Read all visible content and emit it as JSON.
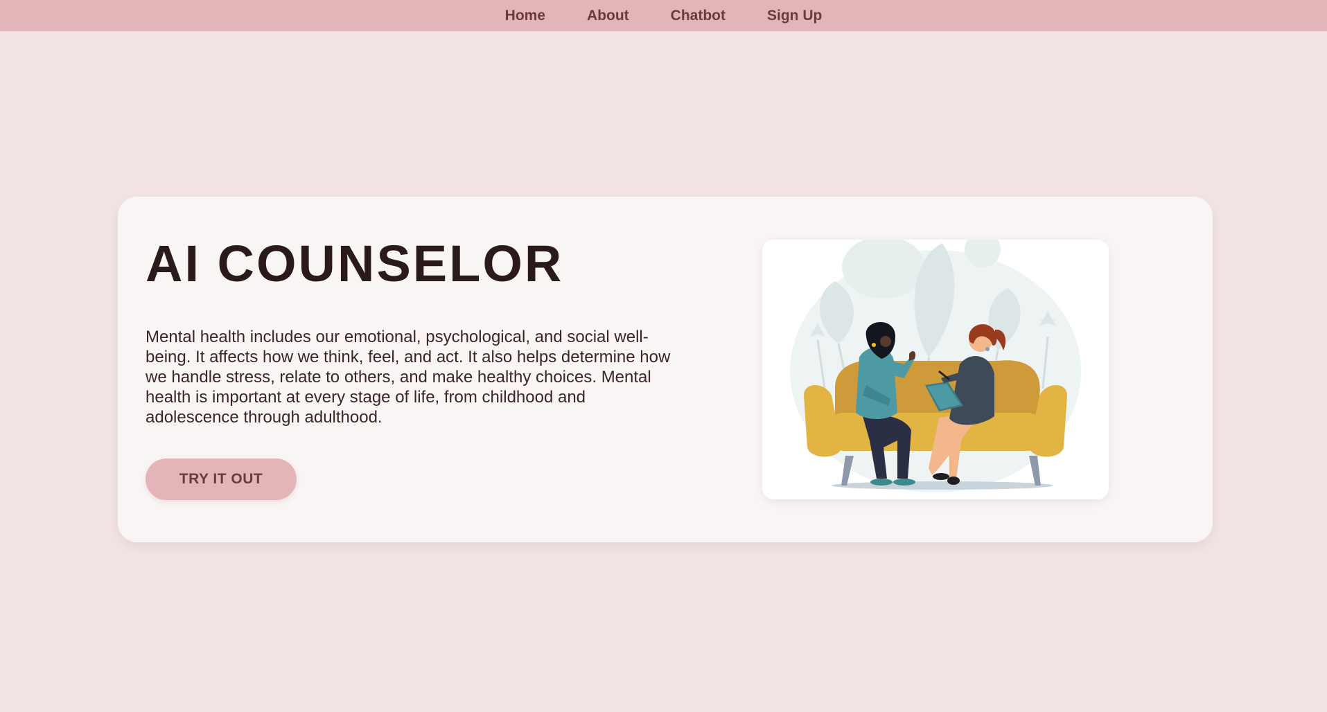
{
  "nav": {
    "items": [
      {
        "label": "Home"
      },
      {
        "label": "About"
      },
      {
        "label": "Chatbot"
      },
      {
        "label": "Sign Up"
      }
    ]
  },
  "hero": {
    "title": "AI COUNSELOR",
    "description": "Mental health includes our emotional, psychological, and social well-being. It affects how we think, feel, and act. It also helps determine how we handle stress, relate to others, and make healthy choices. Mental health is important at every stage of life, from childhood and adolescence through adulthood.",
    "cta_label": "TRY IT OUT"
  },
  "colors": {
    "page_bg": "#f2e4e5",
    "nav_bg": "#e3b5b8",
    "nav_text": "#6b3a3a",
    "card_bg": "#faf5f5",
    "title_text": "#2a1a1a",
    "sofa": "#e2b444"
  },
  "illustration": {
    "icon": "counseling-session-illustration"
  }
}
